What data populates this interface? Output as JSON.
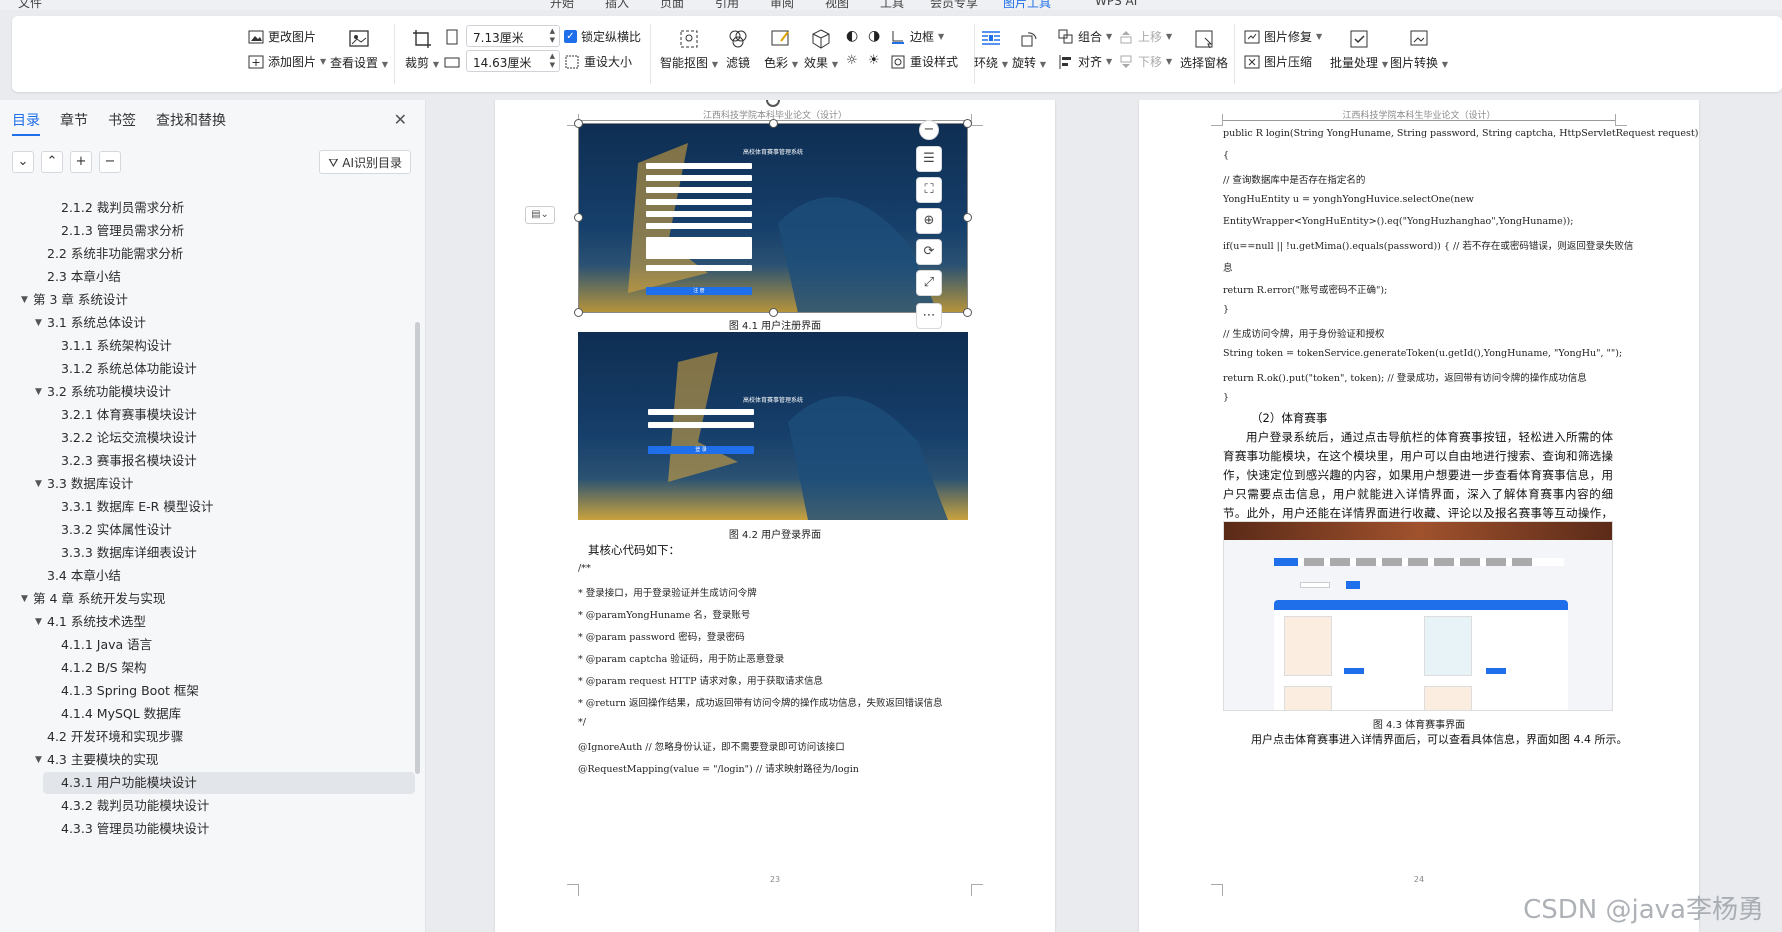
{
  "menu": {
    "items": [
      "文件",
      "开始",
      "插入",
      "页面",
      "引用",
      "审阅",
      "视图",
      "工具",
      "会员专享",
      "图片工具",
      "WPS AI"
    ],
    "active": "图片工具"
  },
  "ribbon": {
    "change_image": "更改图片",
    "add_image": "添加图片",
    "view_settings": "查看设置",
    "crop": "裁剪",
    "width_value": "7.13厘米",
    "height_value": "14.63厘米",
    "lock_ratio": "锁定纵横比",
    "reset_size": "重设大小",
    "smart_cutout": "智能抠图",
    "filter": "滤镜",
    "color": "色彩",
    "effects": "效果",
    "border": "边框",
    "reset_style": "重设样式",
    "wrap": "环绕",
    "rotate": "旋转",
    "group": "组合",
    "align": "对齐",
    "move_up": "上移",
    "move_down": "下移",
    "selection_pane": "选择窗格",
    "image_repair": "图片修复",
    "image_compress": "图片压缩",
    "batch": "批量处理",
    "image_convert": "图片转换"
  },
  "sidebar": {
    "tabs": [
      "目录",
      "章节",
      "书签",
      "查找和替换"
    ],
    "active_tab": "目录",
    "ai_button": "AI识别目录",
    "toc": [
      {
        "text": "2.1.2  裁判员需求分析",
        "level": 3
      },
      {
        "text": "2.1.3  管理员需求分析",
        "level": 3
      },
      {
        "text": "2.2    系统非功能需求分析",
        "level": 2
      },
      {
        "text": "2.3    本章小结",
        "level": 2
      },
      {
        "text": "第 3 章  系统设计",
        "level": 1,
        "expanded": true
      },
      {
        "text": "3.1  系统总体设计",
        "level": 2,
        "expanded": true
      },
      {
        "text": "3.1.1  系统架构设计",
        "level": 3
      },
      {
        "text": "3.1.2  系统总体功能设计",
        "level": 3
      },
      {
        "text": "3.2  系统功能模块设计",
        "level": 2,
        "expanded": true
      },
      {
        "text": "3.2.1  体育赛事模块设计",
        "level": 3
      },
      {
        "text": "3.2.2  论坛交流模块设计",
        "level": 3
      },
      {
        "text": "3.2.3  赛事报名模块设计",
        "level": 3
      },
      {
        "text": "3.3  数据库设计",
        "level": 2,
        "expanded": true
      },
      {
        "text": "3.3.1  数据库 E-R 模型设计",
        "level": 3
      },
      {
        "text": "3.3.2  实体属性设计",
        "level": 3
      },
      {
        "text": "3.3.3  数据库详细表设计",
        "level": 3
      },
      {
        "text": "3.4    本章小结",
        "level": 2
      },
      {
        "text": "第 4 章  系统开发与实现",
        "level": 1,
        "expanded": true
      },
      {
        "text": "4.1  系统技术选型",
        "level": 2,
        "expanded": true
      },
      {
        "text": "4.1.1 Java 语言",
        "level": 3
      },
      {
        "text": "4.1.2 B/S 架构",
        "level": 3
      },
      {
        "text": "4.1.3 Spring Boot 框架",
        "level": 3
      },
      {
        "text": "4.1.4 MySQL 数据库",
        "level": 3
      },
      {
        "text": "4.2  开发环境和实现步骤",
        "level": 2
      },
      {
        "text": "4.3  主要模块的实现",
        "level": 2,
        "expanded": true
      },
      {
        "text": "4.3.1  用户功能模块设计",
        "level": 3,
        "selected": true
      },
      {
        "text": "4.3.2  裁判员功能模块设计",
        "level": 3
      },
      {
        "text": "4.3.3  管理员功能模块设计",
        "level": 3
      }
    ]
  },
  "page1": {
    "header": "江西科技学院本科毕业论文（设计）",
    "fig1_title": "高校体育赛事管理系统",
    "fig1_caption": "图 4.1  用户注册界面",
    "fig1_button": "注 册",
    "fig2_title": "高校体育赛事管理系统",
    "fig2_caption": "图 4.2  用户登录界面",
    "fig2_button": "登 录",
    "intro": "其核心代码如下：",
    "code": [
      "/**",
      " * 登录接口，用于登录验证并生成访问令牌",
      " * @paramYongHuname  名，登录账号",
      " * @param password  密码，登录密码",
      " * @param captcha  验证码，用于防止恶意登录",
      " * @param request HTTP 请求对象，用于获取请求信息",
      " * @return  返回操作结果，成功返回带有访问令牌的操作成功信息，失败返回错误信息",
      " */",
      "@IgnoreAuth // 忽略身份认证，即不需要登录即可访问该接口",
      "@RequestMapping(value = \"/login\") // 请求映射路径为/login"
    ],
    "page_number": "23"
  },
  "page2": {
    "header": "江西科技学院本科生毕业论文（设计）",
    "code": [
      "public R login(String YongHuname, String password, String captcha, HttpServletRequest request)",
      "{",
      "    // 查询数据库中是否存在指定名的",
      "    YongHuEntity              u              =              yonghYongHuvice.selectOne(new",
      "EntityWrapper<YongHuEntity>().eq(\"YongHuzhanghao\",YongHuname));",
      "    if(u==null || !u.getMima().equals(password)) { // 若不存在或密码错误，则返回登录失败信",
      "息",
      "        return R.error(\"账号或密码不正确\");",
      "    }",
      "    // 生成访问令牌，用于身份验证和授权",
      "    String token = tokenService.generateToken(u.getId(),YongHuname, \"YongHu\", \"\");",
      "    return R.ok().put(\"token\", token); // 登录成功，返回带有访问令牌的操作成功信息",
      "}"
    ],
    "section": "（2）体育赛事",
    "paragraph": "用户登录系统后，通过点击导航栏的体育赛事按钮，轻松进入所需的体育赛事功能模块，在这个模块里，用户可以自由地进行搜索、查询和筛选操作，快速定位到感兴趣的内容，如果用户想要进一步查看体育赛事信息，用户只需要点击信息，用户就能进入详情界面，深入了解体育赛事内容的细节。此外，用户还能在详情界面进行收藏、评论以及报名赛事等互动操作，具体如图 4.3 所示。",
    "fig3_caption": "图 4.3  体育赛事界面",
    "after_fig": "用户点击体育赛事进入详情界面后，可以查看具体信息，界面如图 4.4 所示。",
    "page_number": "24"
  },
  "watermark": "CSDN @java李杨勇",
  "colors": {
    "accent": "#1f6feb",
    "fig_bg": "#12355b",
    "fig_sand": "#c9a23d"
  }
}
